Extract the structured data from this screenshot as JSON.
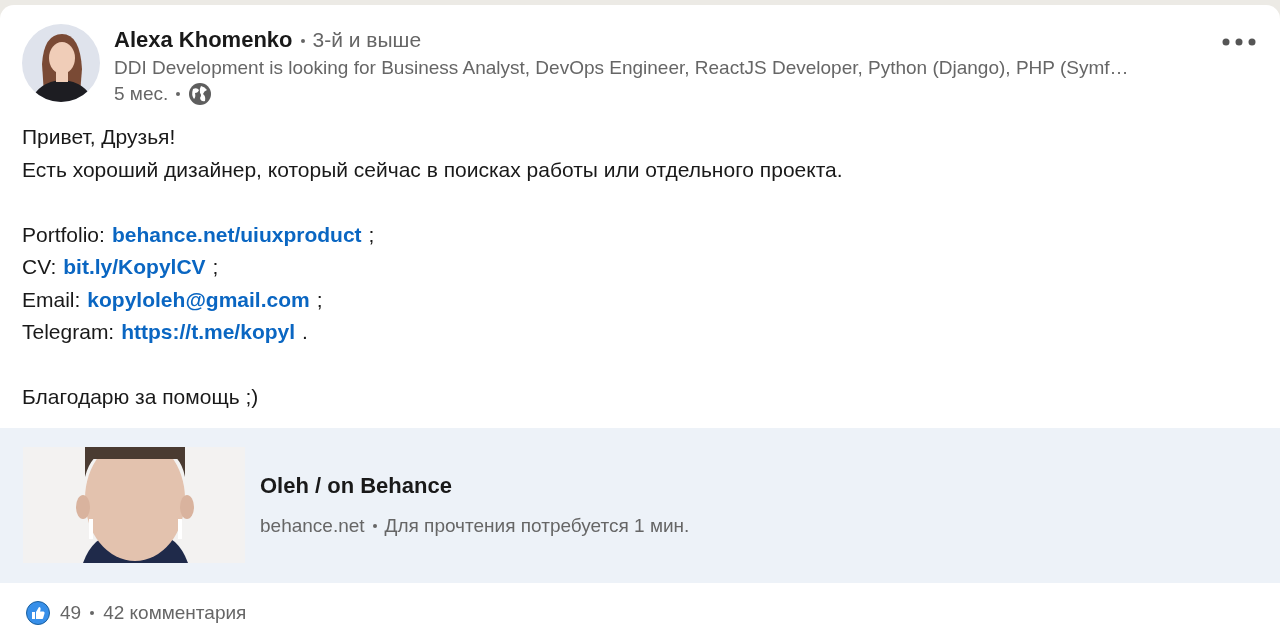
{
  "post": {
    "author": {
      "name": "Alexa Khomenko",
      "degree": "3-й и выше",
      "headline": "DDI Development is looking for Business Analyst, DevOps Engineer, ReactJS Developer, Python (Django), PHP (Symf…",
      "time": "5 мес."
    },
    "body": [
      {
        "kind": "text",
        "text": "Привет, Друзья!"
      },
      {
        "kind": "text",
        "text": "Есть хороший дизайнер, который сейчас в поисках работы или отдельного проекта."
      },
      {
        "kind": "blank"
      },
      {
        "kind": "link",
        "label": "Portfolio:",
        "link": "behance.net/uiuxproduct",
        "suffix": ";"
      },
      {
        "kind": "link",
        "label": "CV:",
        "link": "bit.ly/KopylCV",
        "suffix": ";"
      },
      {
        "kind": "link",
        "label": "Email:",
        "link": "kopyloleh@gmail.com",
        "suffix": ";"
      },
      {
        "kind": "link",
        "label": "Telegram:",
        "link": "https://t.me/kopyl",
        "suffix": "."
      },
      {
        "kind": "blank"
      },
      {
        "kind": "text",
        "text": "Благодарю за помощь ;)"
      }
    ],
    "link_preview": {
      "title": "Oleh / on Behance",
      "source": "behance.net",
      "read_time": "Для прочтения потребуется 1 мин."
    },
    "social": {
      "reactions": "49",
      "comments": "42 комментария"
    }
  }
}
